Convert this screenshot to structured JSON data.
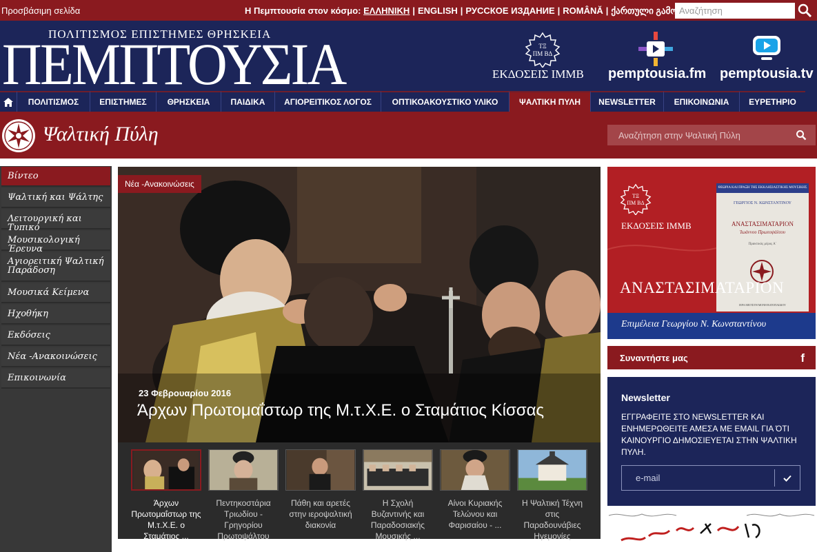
{
  "topbar": {
    "home_link": "Προσβάσιμη σελίδα",
    "world_label": "Η Πεμπτουσία στον κόσμο:",
    "languages": [
      {
        "label": "ΕΛΛΗΝΙΚΗ",
        "active": true
      },
      {
        "label": "ENGLISH",
        "active": false
      },
      {
        "label": "РУССКОЕ ИЗДАНИЕ",
        "active": false
      },
      {
        "label": "ROMÂNĂ",
        "active": false
      },
      {
        "label": "ქართული გამოცემა",
        "active": false
      }
    ],
    "search_placeholder": "Αναζήτηση",
    "search_icon": "search-icon"
  },
  "header": {
    "logo_subtitle": "ΠΟΛΙΤΙΣΜΟΣ ΕΠΙΣΤΗΜΕΣ ΘΡΗΣΚΕΙΑ",
    "logo_title": "ΠΕΜΠΤΟΥΣΙΑ",
    "brands": [
      {
        "label": "ΕΚΔΟΣΕΙΣ ΙΜΜΒ",
        "icon": "immb-seal-icon"
      },
      {
        "label": "pemptousia.fm",
        "icon": "radio-play-icon"
      },
      {
        "label": "pemptousia.tv",
        "icon": "tv-play-icon"
      }
    ]
  },
  "nav": {
    "home_icon": "home-icon",
    "items": [
      {
        "label": "ΠΟΛΙΤΙΣΜΟΣ",
        "active": false
      },
      {
        "label": "ΕΠΙΣΤΗΜΕΣ",
        "active": false
      },
      {
        "label": "ΘΡΗΣΚΕΙΑ",
        "active": false
      },
      {
        "label": "ΠΑΙΔΙΚΑ",
        "active": false
      },
      {
        "label": "ΑΓΙΟΡΕΙΤΙΚΟΣ ΛΟΓΟΣ",
        "active": false
      },
      {
        "label": "ΟΠΤΙΚΟΑΚΟΥΣΤΙΚΟ ΥΛΙΚΟ",
        "active": false
      },
      {
        "label": "ΨΑΛΤΙΚΗ ΠΥΛΗ",
        "active": true
      },
      {
        "label": "NEWSLETTER",
        "active": false
      },
      {
        "label": "ΕΠΙΚΟΙΝΩΝΙΑ",
        "active": false
      },
      {
        "label": "ΕΥΡΕΤΗΡΙΟ",
        "active": false
      }
    ]
  },
  "section": {
    "title": "Ψαλτική Πύλη",
    "emblem_icon": "byzantine-star-emblem-icon",
    "search_placeholder": "Αναζήτηση στην Ψαλτική Πύλη"
  },
  "sidebar": {
    "items": [
      {
        "label": "Βίντεο",
        "active": true
      },
      {
        "label": "Ψαλτική και Ψάλτης",
        "active": false
      },
      {
        "label": "Λειτουργική και Τυπικό",
        "active": false
      },
      {
        "label": "Μουσικολογική Έρευνα",
        "active": false
      },
      {
        "label": "Αγιορειτική Ψαλτική Παράδοση",
        "active": false
      },
      {
        "label": "Μουσικά Κείμενα",
        "active": false
      },
      {
        "label": "Ηχοθήκη",
        "active": false
      },
      {
        "label": "Εκδόσεις",
        "active": false
      },
      {
        "label": "Νέα -Ανακοινώσεις",
        "active": false
      },
      {
        "label": "Επικοινωνία",
        "active": false
      }
    ]
  },
  "feature": {
    "tag": "Νέα -Ανακοινώσεις",
    "date": "23 Φεβρουαρίου 2016",
    "headline": "Άρχων Πρωτομαΐστωρ της Μ.τ.Χ.Ε. ο Σταμάτιος Κίσσας"
  },
  "thumbnails": [
    {
      "caption": "Άρχων Πρωτομαΐστωρ της Μ.τ.Χ.Ε. ο Σταμάτιος ...",
      "active": true
    },
    {
      "caption": "Πεντηκοστάρια Τριωδίου - Γρηγορίου Πρωτοψάλτου",
      "active": false
    },
    {
      "caption": "Πάθη και αρετές στην ιεροψαλτική διακονία",
      "active": false
    },
    {
      "caption": "Η Σχολή Βυζαντινής και Παραδοσιακής Μουσικής ...",
      "active": false
    },
    {
      "caption": "Αίνοι Κυριακής Τελώνου και Φαρισαίου - ...",
      "active": false
    },
    {
      "caption": "Η Ψαλτική Τέχνη στις Παραδουνάβιες Ηγεμονίες",
      "active": false
    }
  ],
  "ad": {
    "publisher": "ΕΚΔΟΣΕΙΣ ΙΜΜΒ",
    "book_header": "ΘΕΩΡΙΑ ΚΑΙ ΠΡΑΞΗ ΤΗΣ ΕΚΚΛΗΣΙΑΣΤΙΚΗΣ ΜΟΥΣΙΚΗΣ",
    "book_author": "ΓΕΩΡΓΙΟΣ Ν. ΚΩΝΣΤΑΝΤΙΝΟΥ",
    "book_cover_title": "ΑΝΑΣΤΑΣΙΜΑΤΑΡΙΟΝ",
    "book_cover_subtitle": "Ἰωάννου Πρωτοψάλτου",
    "book_cover_volume": "Πρακτικός μέρος Α΄",
    "book_cover_publisher": "ΙΕΡΑ ΜΕΓΙΣΤΗ ΜΟΝΗ ΒΑΤΟΠΑΙΔΙΟΥ",
    "title": "ΑΝΑΣΤΑΣΙΜΑΤΑΡΙΟΝ",
    "editor": "Επιμέλεια Γεωργίου Ν. Κωνσταντίνου"
  },
  "social": {
    "label": "Συναντήστε μας",
    "icon": "facebook-icon",
    "glyph": "f"
  },
  "newsletter": {
    "title": "Newsletter",
    "text": "ΕΓΓΡΑΦΕΙΤΕ ΣΤΟ NEWSLETTER ΚΑΙ ΕΝΗΜΕΡΩΘΕΙΤΕ ΑΜΕΣΑ ΜΕ EMAIL ΓΙΑ ΌΤΙ ΚΑΙΝΟΥΡΓΙΟ ΔΗΜΟΣΙΕΥΕΤΑΙ ΣΤΗΝ ΨΑΛΤΙΚΗ ΠΥΛΗ.",
    "email_placeholder": "e-mail",
    "submit_icon": "checkmark-icon"
  },
  "colors": {
    "brand_red": "#8a1a1f",
    "brand_navy": "#1c2559",
    "sidebar_gray": "#3b3b3b"
  }
}
